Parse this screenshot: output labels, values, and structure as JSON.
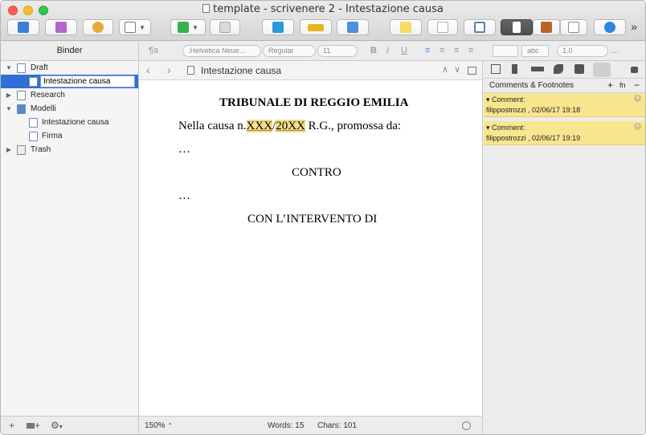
{
  "window": {
    "title": "template - scrivenere 2 - Intestazione causa"
  },
  "toolbar": {
    "more": "»"
  },
  "formatbar": {
    "paragraph": "¶a",
    "font_family": ".Helvetica Neue...",
    "font_style": "Regular",
    "font_size": "11",
    "bold": "B",
    "italic": "I",
    "underline": "U",
    "highlight": "abc",
    "line_spacing": "1.0",
    "overflow": "..."
  },
  "binder": {
    "header": "Binder",
    "items": [
      {
        "label": "Draft"
      },
      {
        "label": "Intestazione causa"
      },
      {
        "label": "Research"
      },
      {
        "label": "Modelli"
      },
      {
        "label": "Intestazione causa"
      },
      {
        "label": "Firma"
      },
      {
        "label": "Trash"
      }
    ],
    "footer": {
      "add": "+",
      "add_folder": "+",
      "settings": "⚙"
    }
  },
  "editor": {
    "header_title": "Intestazione causa",
    "text": {
      "l1": "TRIBUNALE DI REGGIO EMILIA",
      "l2a": "Nella causa n.",
      "l2b": "XXX",
      "l2c": "/",
      "l2d": "20XX",
      "l2e": " R.G., promossa da:",
      "l3": "…",
      "l4": "CONTRO",
      "l5": "…",
      "l6": "CON L’INTERVENTO DI"
    },
    "footer": {
      "zoom": "150%",
      "words": "Words: 15",
      "chars": "Chars: 101"
    }
  },
  "inspector": {
    "header": "Comments & Footnotes",
    "add_comment": "+",
    "add_footnote": "fn",
    "remove": "−",
    "comments": [
      {
        "label": "Comment:",
        "meta": "filippostrozzi , 02/06/17 19:18"
      },
      {
        "label": "Comment:",
        "meta": "filippostrozzi , 02/06/17 19:19"
      }
    ]
  },
  "colors": {
    "selection": "#2f6fd6",
    "comment_bg": "#f8e68f",
    "highlight": "#f3dd8a"
  }
}
